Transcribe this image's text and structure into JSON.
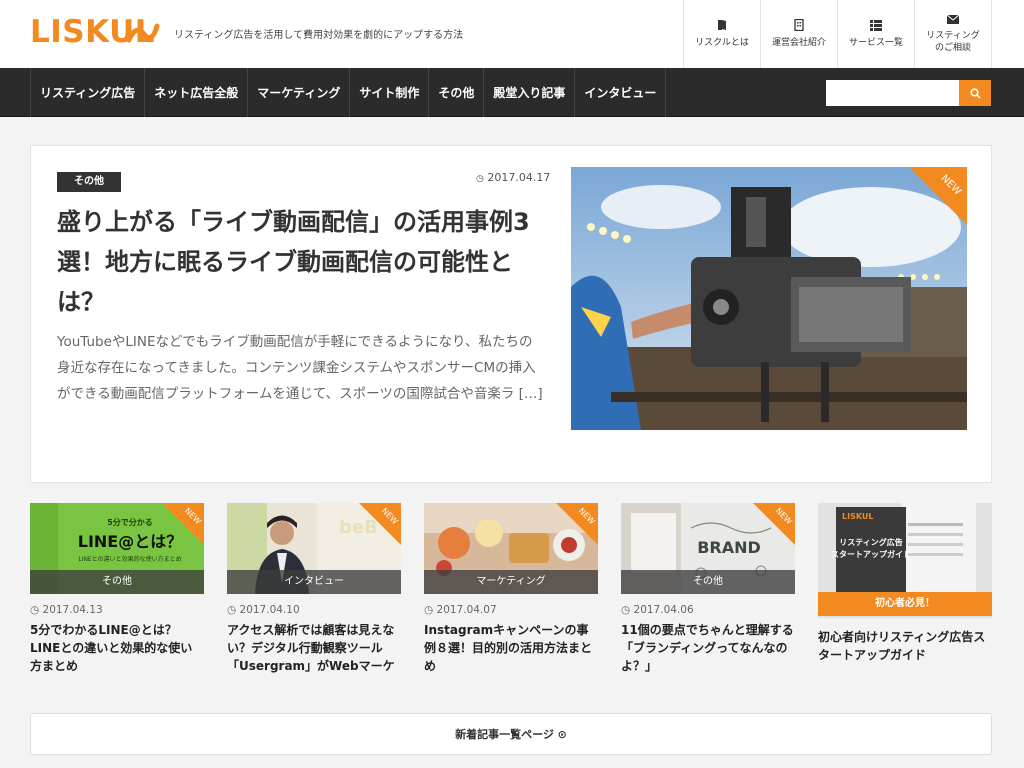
{
  "header": {
    "logo_text": "LISKUL",
    "tagline": "リスティング広告を活用して費用対効果を劇的にアップする方法",
    "util_nav": [
      {
        "icon": "book-icon",
        "label": "リスクルとは"
      },
      {
        "icon": "building-icon",
        "label": "運営会社紹介"
      },
      {
        "icon": "list-icon",
        "label": "サービス一覧"
      },
      {
        "icon": "mail-icon",
        "label": "リスティング\nのご相談"
      }
    ]
  },
  "nav": {
    "items": [
      "リスティング広告",
      "ネット広告全般",
      "マーケティング",
      "サイト制作",
      "その他",
      "殿堂入り記事",
      "インタビュー"
    ],
    "search_placeholder": ""
  },
  "featured": {
    "category": "その他",
    "date": "2017.04.17",
    "title": "盛り上がる「ライブ動画配信」の活用事例3選！地方に眠るライブ動画配信の可能性とは？",
    "excerpt": "YouTubeやLINEなどでもライブ動画配信が手軽にできるようになり、私たちの身近な存在になってきました。コンテンツ課金システムやスポンサーCMの挿入ができる動画配信プラットフォームを通じて、スポーツの国際試合や音楽ラ […]",
    "badge": "NEW"
  },
  "cards": [
    {
      "category": "その他",
      "date": "2017.04.13",
      "title": "5分でわかるLINE@とは？LINEとの違いと効果的な使い方まとめ",
      "badge": "NEW",
      "img_text_1": "5分で分かる",
      "img_text_2": "LINE@とは？",
      "img_text_3": "LINEとの違いと効果的な使い方まとめ"
    },
    {
      "category": "インタビュー",
      "date": "2017.04.10",
      "title": "アクセス解析では顧客は見えない？デジタル行動観察ツール「Usergram」がWebマーケ",
      "badge": "NEW",
      "img_text_1": "beB"
    },
    {
      "category": "マーケティング",
      "date": "2017.04.07",
      "title": "Instagramキャンペーンの事例８選！目的別の活用方法まとめ",
      "badge": "NEW"
    },
    {
      "category": "その他",
      "date": "2017.04.06",
      "title": "11個の要点でちゃんと理解する「ブランディングってなんなのよ？」",
      "badge": "NEW",
      "img_text_1": "BRAND"
    }
  ],
  "ad": {
    "logo": "LISKUL",
    "book_title": "リスティング広告\nスタートアップガイド",
    "banner": "初心者必見！",
    "title": "初心者向けリスティング広告スタートアップガイド"
  },
  "more_button": "新着記事一覧ページ ⊙",
  "colors": {
    "accent": "#f28a1f",
    "nav_bg": "#2b2b2b",
    "badge_bg": "#333333"
  }
}
